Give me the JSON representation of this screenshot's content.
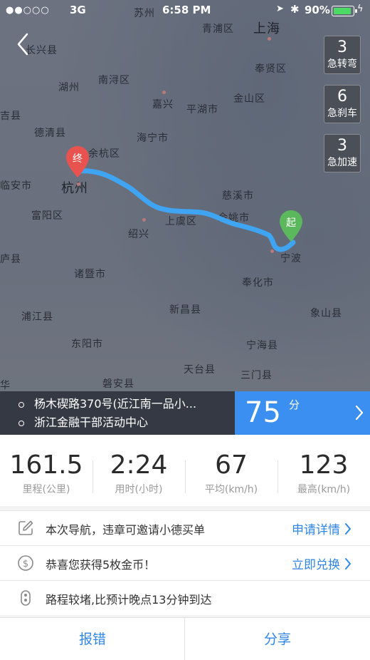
{
  "status_bar": {
    "signal": "●●○○○",
    "carrier": "3G",
    "time": "6:58 PM",
    "battery": "90%"
  },
  "map": {
    "cities": [
      {
        "name": "上海",
        "big": true
      },
      {
        "name": "青浦区"
      },
      {
        "name": "苏州"
      },
      {
        "name": "长兴县"
      },
      {
        "name": "南浔区"
      },
      {
        "name": "奉贤区"
      },
      {
        "name": "湖州"
      },
      {
        "name": "嘉兴"
      },
      {
        "name": "金山区"
      },
      {
        "name": "平湖市"
      },
      {
        "name": "吉县"
      },
      {
        "name": "德清县"
      },
      {
        "name": "海宁市"
      },
      {
        "name": "杭州",
        "big": true
      },
      {
        "name": "富阳区"
      },
      {
        "name": "临安市"
      },
      {
        "name": "绍兴"
      },
      {
        "name": "上虞区"
      },
      {
        "name": "慈溪市"
      },
      {
        "name": "余姚市"
      },
      {
        "name": "宁波"
      },
      {
        "name": "诸暨市"
      },
      {
        "name": "奉化市"
      },
      {
        "name": "庐县"
      },
      {
        "name": "浦江县"
      },
      {
        "name": "新昌县"
      },
      {
        "name": "象山县"
      },
      {
        "name": "东阳市"
      },
      {
        "name": "宁海县"
      },
      {
        "name": "天台县"
      },
      {
        "name": "三门县"
      },
      {
        "name": "磐安县"
      },
      {
        "name": "华"
      },
      {
        "name": "余杭区"
      }
    ],
    "start_marker": "起",
    "end_marker": "终",
    "route_color": "#3fa4f2"
  },
  "events": [
    {
      "count": "3",
      "label": "急转弯"
    },
    {
      "count": "6",
      "label": "急刹车"
    },
    {
      "count": "3",
      "label": "急加速"
    }
  ],
  "route": {
    "from": "杨木碶路370号(近江南一品小...",
    "to": "浙江金融干部活动中心",
    "score": "75",
    "score_unit": "分"
  },
  "stats": [
    {
      "value": "161.5",
      "label": "里程(公里)"
    },
    {
      "value": "2:24",
      "label": "用时(小时)"
    },
    {
      "value": "67",
      "label": "平均(km/h)"
    },
    {
      "value": "123",
      "label": "最高(km/h)"
    }
  ],
  "items": [
    {
      "text": "本次导航，违章可邀请小德买单",
      "link": "申请详情",
      "icon": "pen-icon"
    },
    {
      "text": "恭喜您获得5枚金币！",
      "link": "立即兑换",
      "icon": "coin-icon"
    },
    {
      "text": "路程较堵,比预计晚点13分钟到达",
      "link": "",
      "icon": "traffic-light-icon"
    }
  ],
  "buttons": {
    "report": "报错",
    "share": "分享"
  },
  "colors": {
    "accent": "#2f86e8",
    "score_bg": "#3a8ff0",
    "start_pin": "#5cb85c",
    "end_pin": "#e9534f"
  }
}
